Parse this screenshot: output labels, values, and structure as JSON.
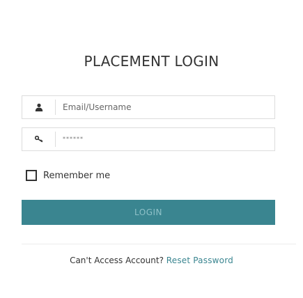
{
  "login_form": {
    "title": "PLACEMENT LOGIN",
    "username": {
      "placeholder": "Email/Username",
      "icon": "user-icon"
    },
    "password": {
      "masked_value": "******",
      "icon": "key-icon"
    },
    "remember": {
      "label": "Remember me",
      "checked": false
    },
    "submit_label": "LOGIN"
  },
  "footer": {
    "question": "Can't Access Account?",
    "reset_link": "Reset Password"
  },
  "colors": {
    "accent": "#3a8590",
    "button_text": "#8fc1c8",
    "border": "#dcdcdc",
    "text": "#333333"
  }
}
